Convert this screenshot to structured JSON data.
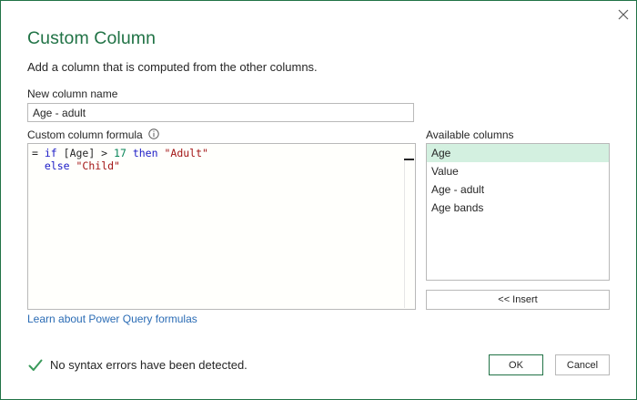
{
  "dialog": {
    "title": "Custom Column",
    "subtitle": "Add a column that is computed from the other columns.",
    "close_icon": "close-icon"
  },
  "new_column": {
    "label": "New column name",
    "value": "Age - adult"
  },
  "formula": {
    "label": "Custom column formula",
    "info_icon": "info-icon",
    "line1": {
      "eq": "= ",
      "kw_if": "if",
      "col": " [Age] > ",
      "num": "17",
      "sp": " ",
      "kw_then": "then",
      "sp2": " ",
      "str_adult": "\"Adult\""
    },
    "line2": {
      "indent": "  ",
      "kw_else": "else",
      "sp": " ",
      "str_child": "\"Child\""
    }
  },
  "learn_link": "Learn about Power Query formulas",
  "available": {
    "label": "Available columns",
    "items": [
      "Age",
      "Value",
      "Age - adult",
      "Age bands"
    ],
    "selected_index": 0,
    "insert_label": "<< Insert"
  },
  "status": {
    "icon": "checkmark-icon",
    "message": "No syntax errors have been detected."
  },
  "buttons": {
    "ok": "OK",
    "cancel": "Cancel"
  },
  "colors": {
    "accent": "#217346",
    "link": "#2b6cb5",
    "selected_bg": "#d3f0e0",
    "keyword": "#1b1bc6",
    "string": "#a31515",
    "number": "#098658"
  }
}
